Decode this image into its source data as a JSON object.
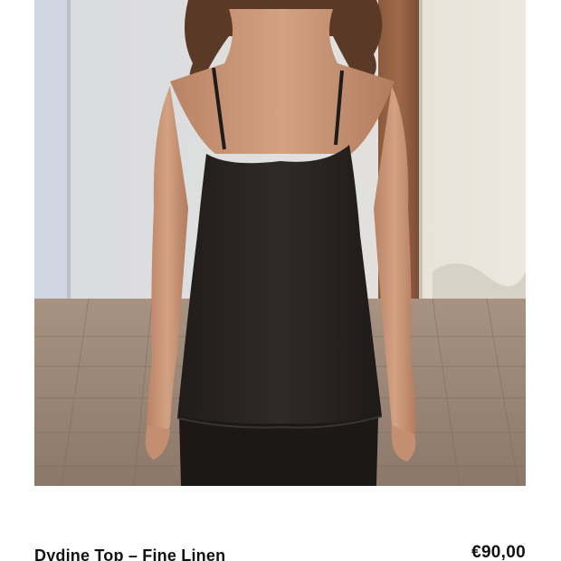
{
  "product": {
    "image_alt": "Model wearing black linen camisole top",
    "title": "Dydine Top – Fine Linen",
    "price": "€90,00"
  },
  "colors": {
    "background": "#ffffff",
    "text": "#111111",
    "garment": "#2b2623"
  }
}
